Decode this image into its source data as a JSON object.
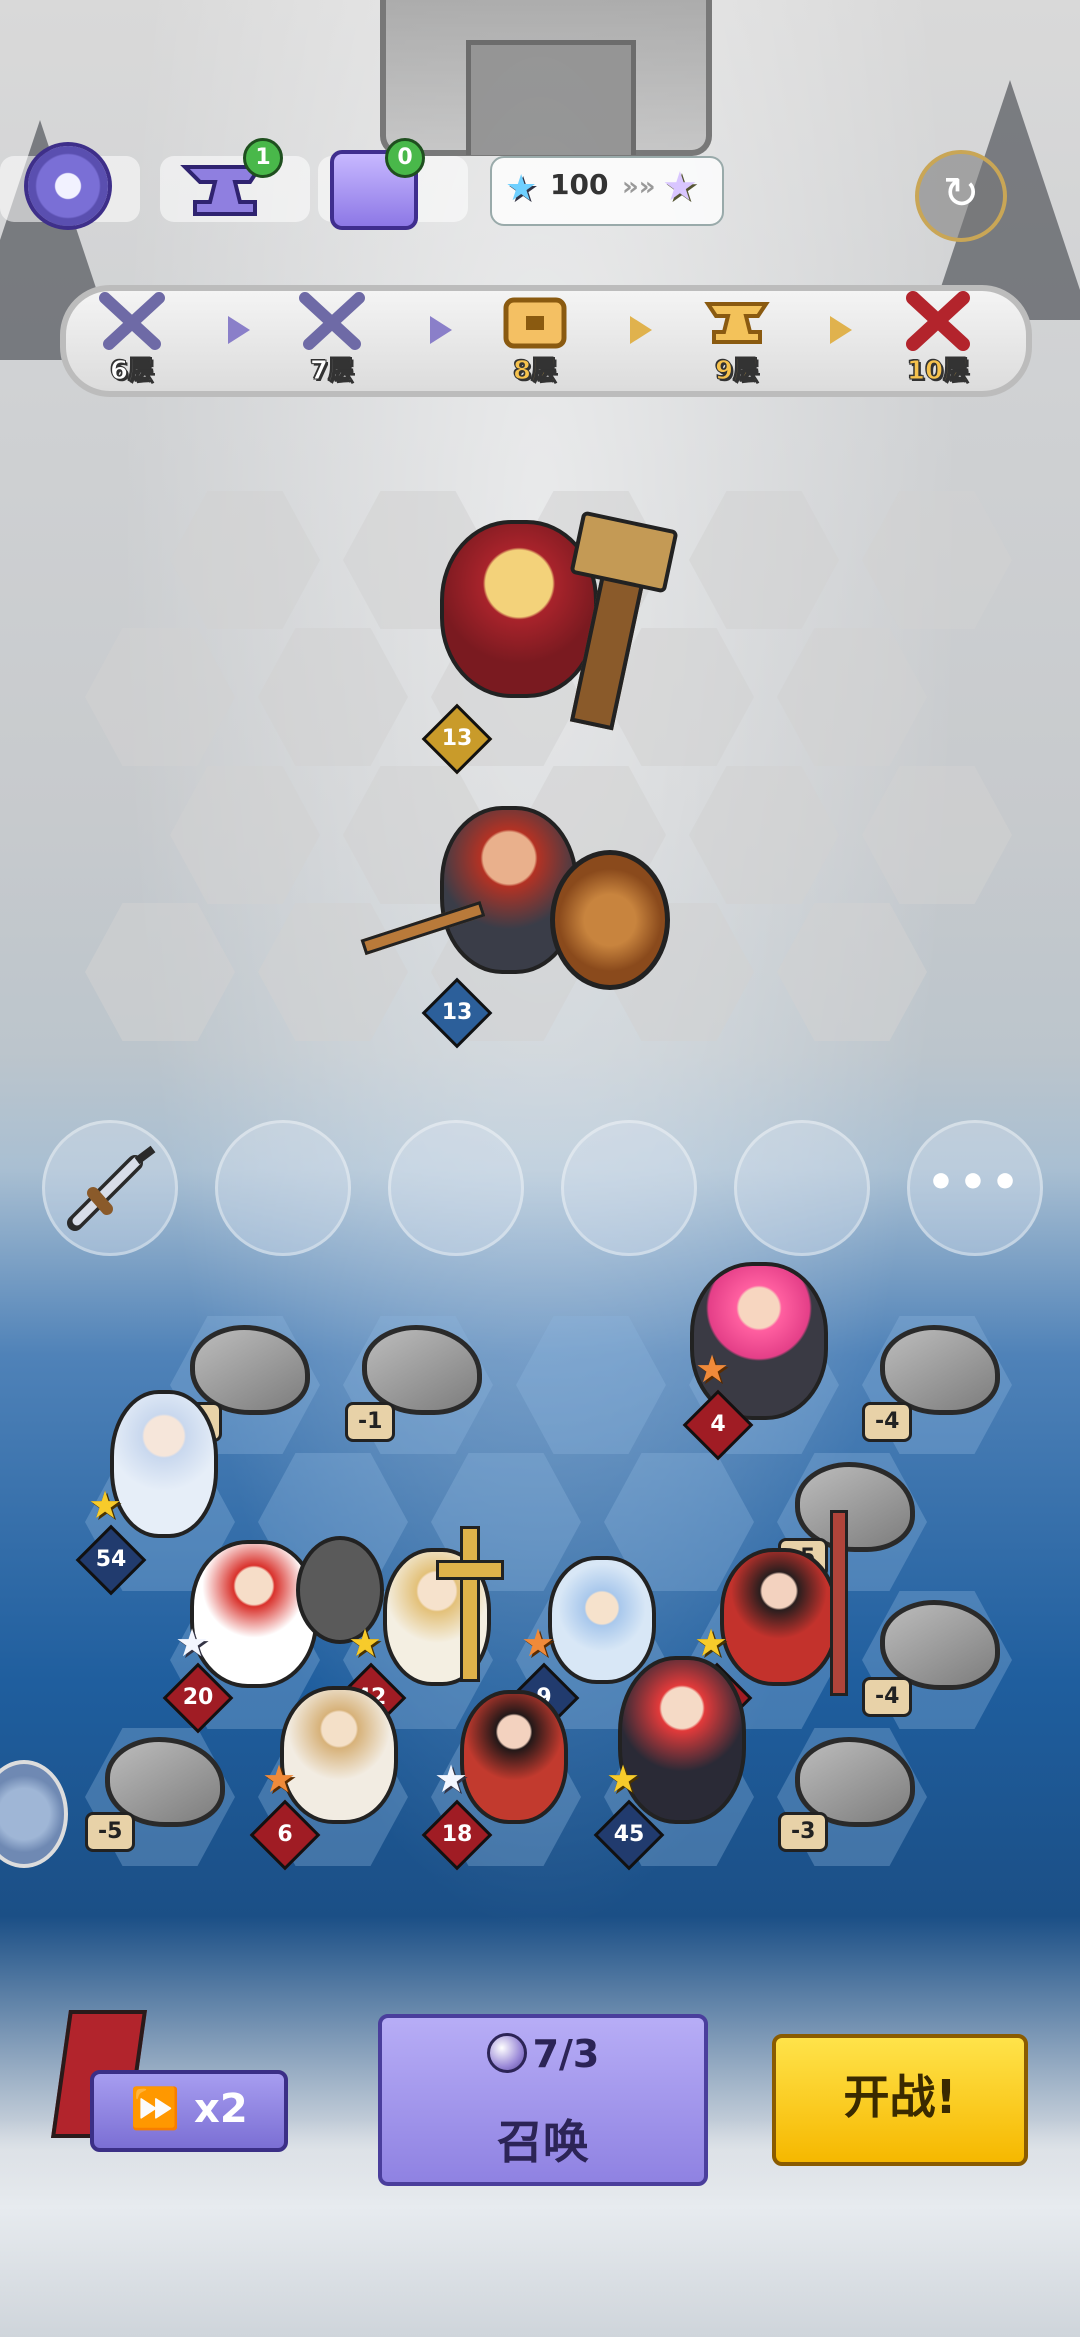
{
  "top_bar": {
    "anvil_badge": "1",
    "chest_badge": "0",
    "star_value": "100"
  },
  "stages": [
    {
      "label": "6层",
      "icon": "crossed-swords-icon",
      "state": "cleared"
    },
    {
      "label": "7层",
      "icon": "crossed-swords-icon",
      "state": "cleared"
    },
    {
      "label": "8层",
      "icon": "treasure-chest-icon",
      "state": "current"
    },
    {
      "label": "9层",
      "icon": "anvil-icon",
      "state": "upcoming"
    },
    {
      "label": "10层",
      "icon": "boss-axes-icon",
      "state": "boss"
    }
  ],
  "enemies": [
    {
      "name": "viking-hammer-boss",
      "level": "13"
    },
    {
      "name": "dwarf-shield-warrior",
      "level": "13"
    }
  ],
  "equipment_slots": {
    "first_item": "sword-icon",
    "more": "•••"
  },
  "rocks": [
    "-1",
    "-1",
    "-4",
    "-5",
    "-4",
    "-5",
    "-3"
  ],
  "heroes": [
    {
      "level": "4",
      "star": "orange"
    },
    {
      "level": "54",
      "star": "gold"
    },
    {
      "level": "20",
      "star": "white"
    },
    {
      "level": "42",
      "star": "gold"
    },
    {
      "level": "9",
      "star": "orange"
    },
    {
      "level": "48",
      "star": "gold"
    },
    {
      "level": "6",
      "star": "orange"
    },
    {
      "level": "18",
      "star": "white"
    },
    {
      "level": "45",
      "star": "gold"
    }
  ],
  "controls": {
    "speed": "x2",
    "summon_cost": "7/3",
    "summon_label": "召唤",
    "fight_label": "开战!"
  }
}
